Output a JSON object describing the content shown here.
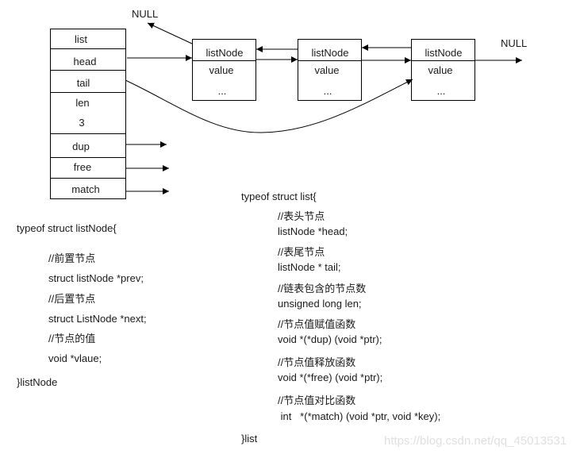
{
  "diagram": {
    "list_struct": {
      "title": "list",
      "fields": [
        "head",
        "tail",
        "len",
        "3",
        "dup",
        "free",
        "match"
      ]
    },
    "nodes": [
      {
        "title": "listNode",
        "field": "value",
        "more": "..."
      },
      {
        "title": "listNode",
        "field": "value",
        "more": "..."
      },
      {
        "title": "listNode",
        "field": "value",
        "more": "..."
      }
    ],
    "null_left": "NULL",
    "null_right": "NULL"
  },
  "code_listnode": {
    "open": "typeof struct listNode{",
    "lines": [
      "//前置节点",
      "struct listNode *prev;",
      "//后置节点",
      "struct ListNode *next;",
      "//节点的值",
      "void *vlaue;"
    ],
    "close": "}listNode"
  },
  "code_list": {
    "open": "typeof struct list{",
    "groups": [
      {
        "comment": "//表头节点",
        "code": "listNode *head;"
      },
      {
        "comment": "//表尾节点",
        "code": "listNode * tail;"
      },
      {
        "comment": "//链表包含的节点数",
        "code": "unsigned long len;"
      },
      {
        "comment": "//节点值赋值函数",
        "code": "void *(*dup) (void *ptr);"
      },
      {
        "comment": "//节点值释放函数",
        "code": "void *(*free) (void *ptr);"
      },
      {
        "comment": "//节点值对比函数",
        "code": " int   *(*match) (void *ptr, void *key);"
      }
    ],
    "close": "}list"
  },
  "watermark": "https://blog.csdn.net/qq_45013531"
}
